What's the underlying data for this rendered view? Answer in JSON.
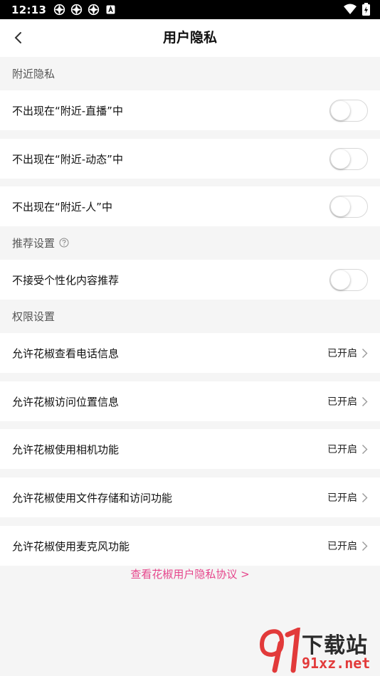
{
  "status_bar": {
    "time": "12:13"
  },
  "nav": {
    "title": "用户隐私"
  },
  "sections": {
    "nearby": {
      "title": "附近隐私",
      "rows": [
        {
          "label": "不出现在“附近-直播”中",
          "enabled": false
        },
        {
          "label": "不出现在“附近-动态”中",
          "enabled": false
        },
        {
          "label": "不出现在“附近-人”中",
          "enabled": false
        }
      ]
    },
    "recommend": {
      "title": "推荐设置",
      "rows": [
        {
          "label": "不接受个性化内容推荐",
          "enabled": false
        }
      ]
    },
    "permissions": {
      "title": "权限设置",
      "rows": [
        {
          "label": "允许花椒查看电话信息",
          "status": "已开启"
        },
        {
          "label": "允许花椒访问位置信息",
          "status": "已开启"
        },
        {
          "label": "允许花椒使用相机功能",
          "status": "已开启"
        },
        {
          "label": "允许花椒使用文件存储和访问功能",
          "status": "已开启"
        },
        {
          "label": "允许花椒使用麦克风功能",
          "status": "已开启"
        }
      ]
    }
  },
  "footer": {
    "policy_link": "查看花椒用户隐私协议 >"
  },
  "watermark": {
    "brand": "下载站",
    "domain": "91xz.net"
  },
  "colors": {
    "accent_pink": "#e6468c",
    "watermark_red": "#e23a3a"
  }
}
